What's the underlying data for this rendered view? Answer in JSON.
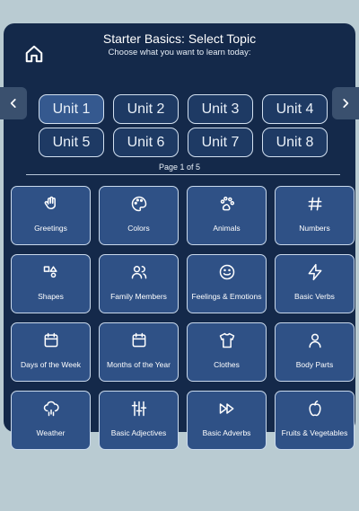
{
  "header": {
    "title": "Starter Basics: Select Topic",
    "subtitle": "Choose what you want to learn today:"
  },
  "units": [
    {
      "label": "Unit 1",
      "active": true
    },
    {
      "label": "Unit 2",
      "active": false
    },
    {
      "label": "Unit 3",
      "active": false
    },
    {
      "label": "Unit 4",
      "active": false
    },
    {
      "label": "Unit 5",
      "active": false
    },
    {
      "label": "Unit 6",
      "active": false
    },
    {
      "label": "Unit 7",
      "active": false
    },
    {
      "label": "Unit 8",
      "active": false
    }
  ],
  "pagination": {
    "label": "Page 1 of 5"
  },
  "topics": [
    {
      "label": "Greetings",
      "icon": "waving-hand-icon"
    },
    {
      "label": "Colors",
      "icon": "palette-icon"
    },
    {
      "label": "Animals",
      "icon": "paw-icon"
    },
    {
      "label": "Numbers",
      "icon": "hash-icon"
    },
    {
      "label": "Shapes",
      "icon": "shapes-icon"
    },
    {
      "label": "Family Members",
      "icon": "users-icon"
    },
    {
      "label": "Feelings & Emotions",
      "icon": "smile-icon"
    },
    {
      "label": "Basic Verbs",
      "icon": "lightning-icon"
    },
    {
      "label": "Days of the Week",
      "icon": "calendar-icon"
    },
    {
      "label": "Months of the Year",
      "icon": "calendar-icon"
    },
    {
      "label": "Clothes",
      "icon": "shirt-icon"
    },
    {
      "label": "Body Parts",
      "icon": "person-icon"
    },
    {
      "label": "Weather",
      "icon": "cloud-rain-icon"
    },
    {
      "label": "Basic Adjectives",
      "icon": "sliders-icon"
    },
    {
      "label": "Basic Adverbs",
      "icon": "fast-forward-icon"
    },
    {
      "label": "Fruits & Vegetables",
      "icon": "apple-icon"
    }
  ],
  "colors": {
    "background": "#b9cbd2",
    "panel": "#14294a",
    "tile": "#2f5186",
    "unit_active": "#35598f"
  }
}
